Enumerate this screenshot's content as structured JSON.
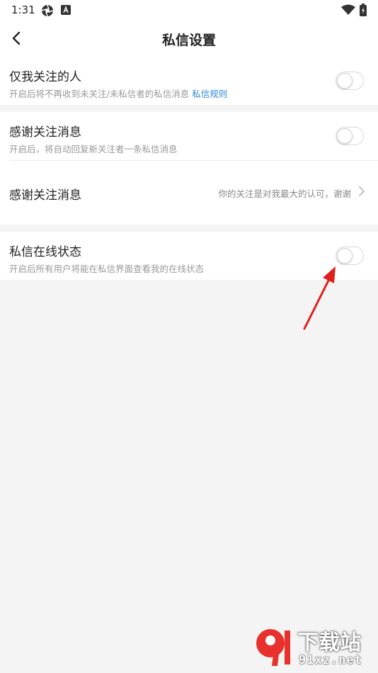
{
  "status_bar": {
    "time": "1:31",
    "icons": [
      "aperture-icon",
      "keyboard-a-icon",
      "wifi-icon",
      "battery-icon"
    ]
  },
  "header": {
    "title": "私信设置",
    "back_icon": "back-arrow-icon"
  },
  "settings": {
    "only_following": {
      "label": "仅我关注的人",
      "desc": "开启后将不再收到未关注/未私信者的私信消息",
      "link": "私信规则",
      "enabled": false
    },
    "thanks_follow_toggle": {
      "label": "感谢关注消息",
      "desc": "开启后，将自动回复新关注者一条私信消息",
      "enabled": false
    },
    "thanks_follow_message": {
      "label": "感谢关注消息",
      "value": "你的关注是对我最大的认可，谢谢",
      "chevron_icon": "chevron-right-icon"
    },
    "online_status": {
      "label": "私信在线状态",
      "desc": "开启后所有用户将能在私信界面查看我的在线状态",
      "enabled": false
    }
  },
  "annotation": {
    "arrow_color": "#e0201c"
  },
  "watermark": {
    "top": "下载站",
    "bottom": "91xz.net"
  },
  "colors": {
    "link": "#2f88d6",
    "background": "#f4f4f4"
  }
}
